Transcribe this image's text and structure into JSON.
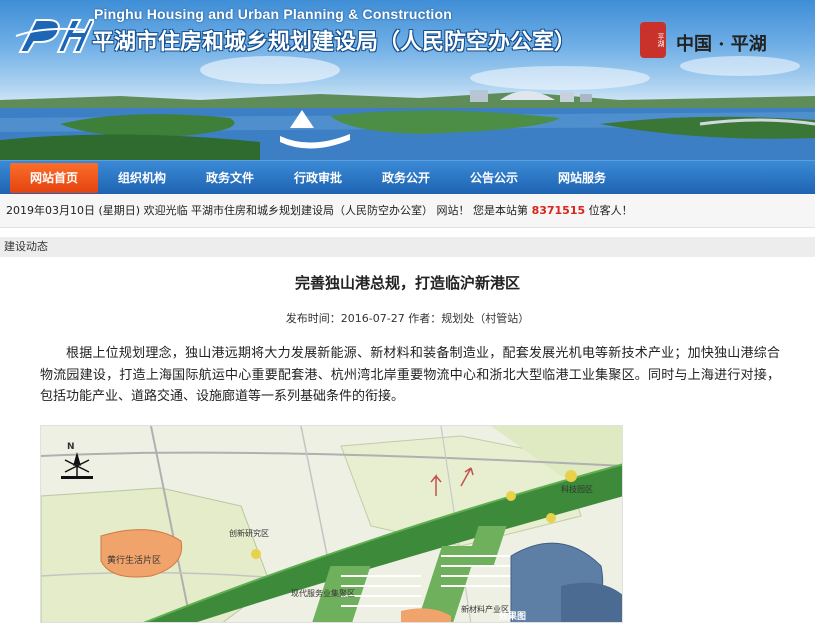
{
  "header": {
    "logo_letters": "PH",
    "title_en": "Pinghu Housing and Urban Planning  & Construction",
    "title_cn": "平湖市住房和城乡规划建设局（人民防空办公室）",
    "seal_glyph": "平湖",
    "seal_text": "中国 · 平湖"
  },
  "nav": {
    "items": [
      {
        "label": "网站首页",
        "active": true
      },
      {
        "label": "组织机构"
      },
      {
        "label": "政务文件"
      },
      {
        "label": "行政审批"
      },
      {
        "label": "政务公开"
      },
      {
        "label": "公告公示"
      },
      {
        "label": "网站服务"
      }
    ]
  },
  "welcome": {
    "prefix": "2019年03月10日 (星期日) 欢迎光临 平湖市住房和城乡规划建设局（人民防空办公室） 网站！ 您是本站第 ",
    "count": "8371515",
    "suffix": " 位客人！"
  },
  "section": {
    "label": "建设动态"
  },
  "article": {
    "title": "完善独山港总规，打造临沪新港区",
    "meta": "发布时间：2016-07-27    作者：规划处（村管站）",
    "body": "根据上位规划理念，独山港远期将大力发展新能源、新材料和装备制造业，配套发展光机电等新技术产业；加快独山港综合物流园建设，打造上海国际航运中心重要配套港、杭州湾北岸重要物流中心和浙北大型临港工业集聚区。同时与上海进行对接，包括功能产业、道路交通、设施廊道等一系列基础条件的衔接。"
  },
  "map": {
    "labels": {
      "north": "N",
      "zone_left": "黄行生活片区",
      "point_a": "创新研究区",
      "point_b": "现代服务业集聚区",
      "point_c": "新材料产业区",
      "point_d": "科技园区",
      "point_e": "效果图"
    }
  },
  "colors": {
    "nav_bg": "#1d62b0",
    "nav_active": "#e4430f",
    "count_red": "#d9241b",
    "corridor_green": "#3d8a3a",
    "zone_orange": "#f0a36b",
    "harbor_blue": "#5d7fa6"
  }
}
